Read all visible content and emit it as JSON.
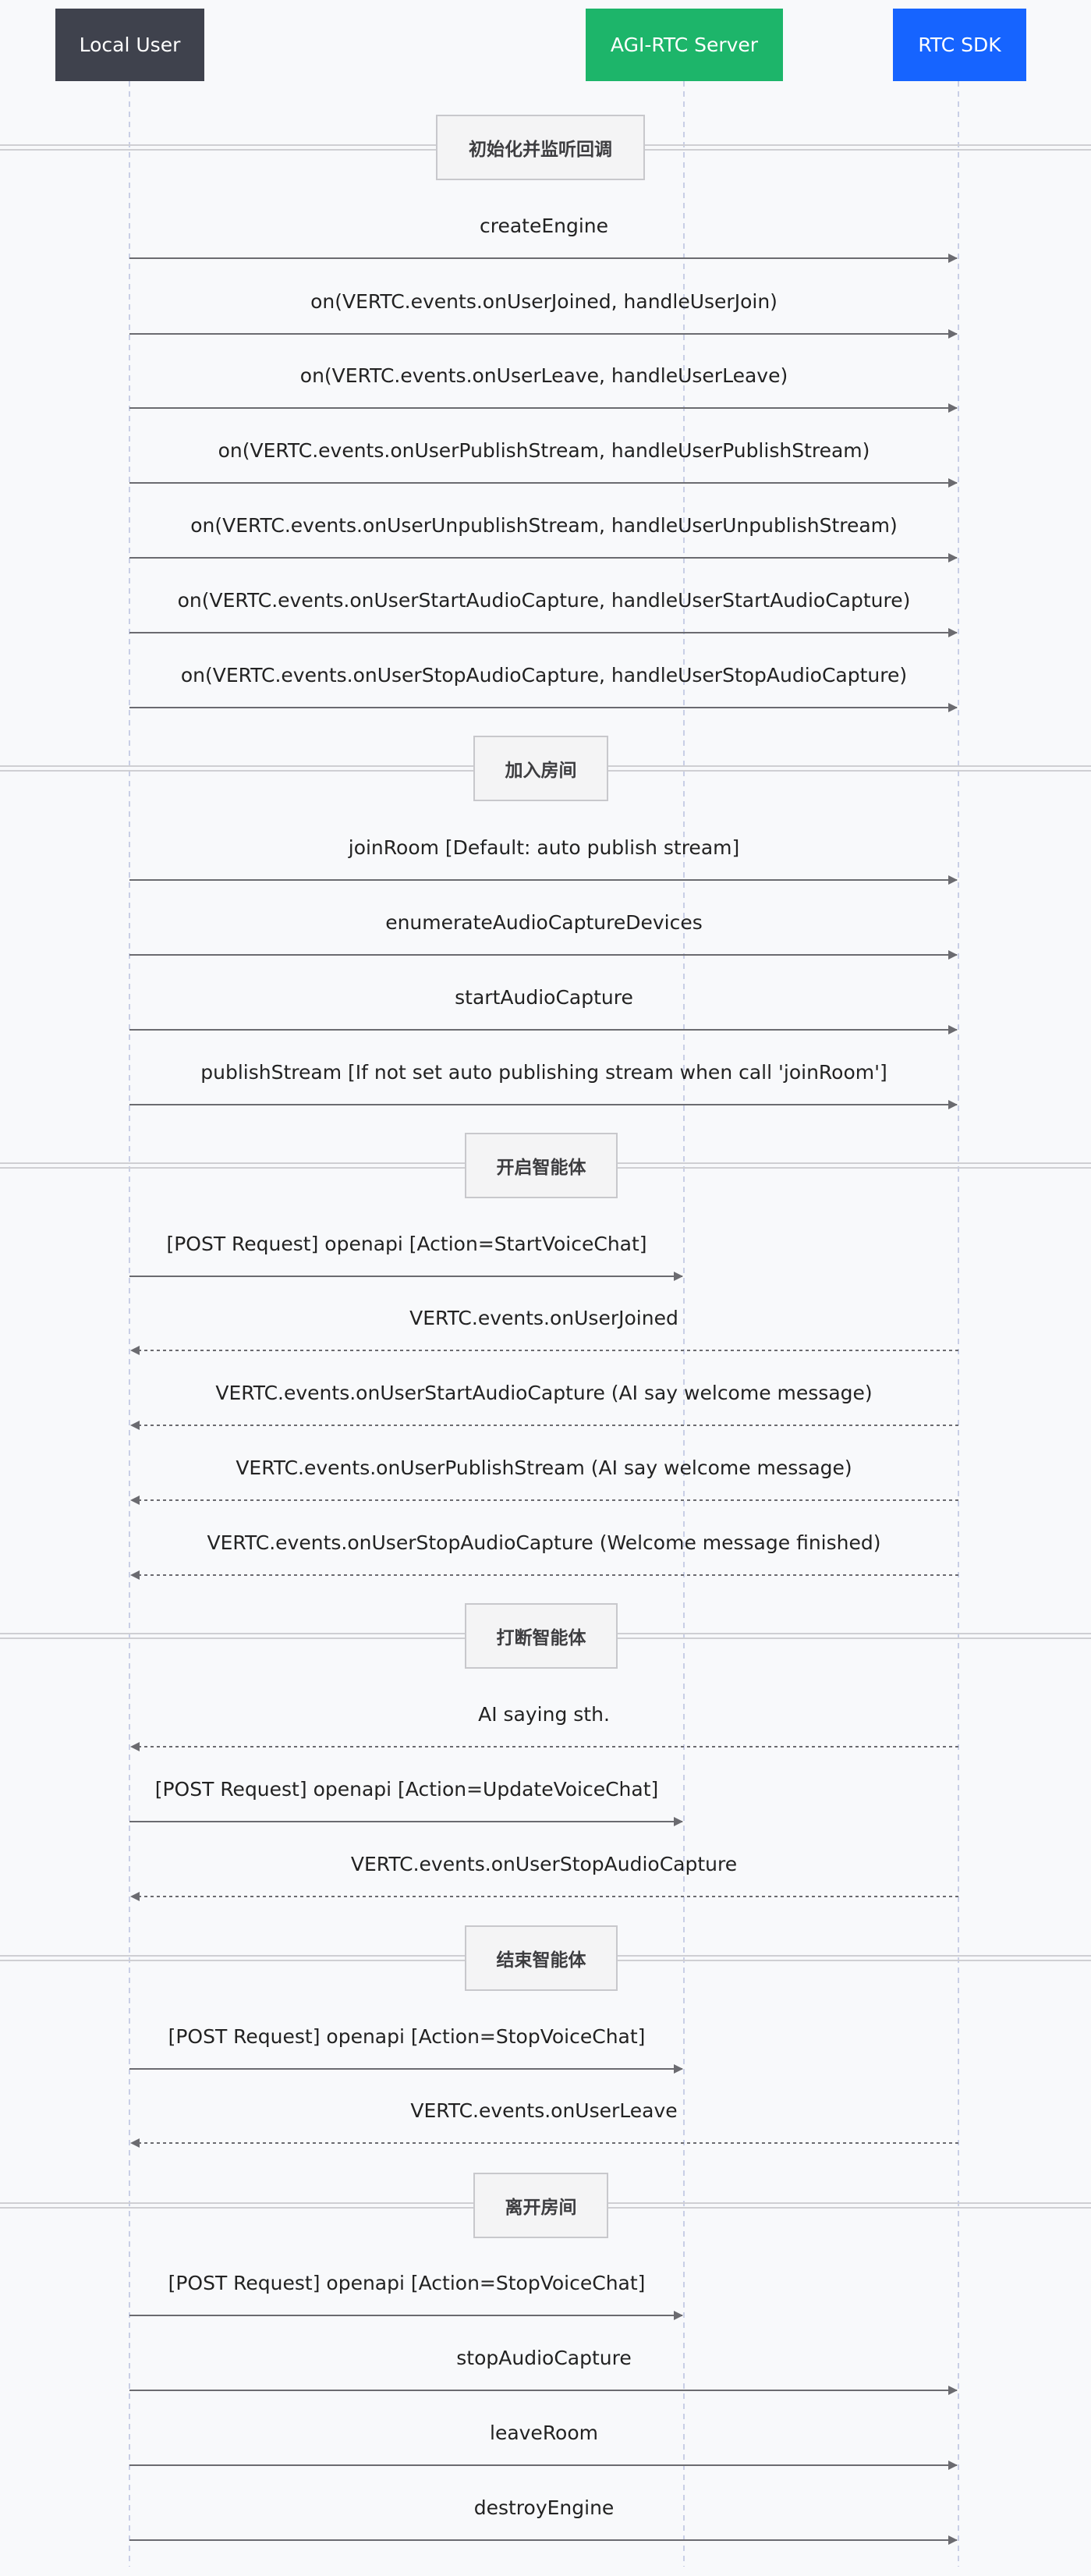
{
  "participants": [
    {
      "id": "local",
      "name": "Local User",
      "color": "#3f424d"
    },
    {
      "id": "server",
      "name": "AGI-RTC Server",
      "color": "#1db56a"
    },
    {
      "id": "sdk",
      "name": "RTC SDK",
      "color": "#1664ff"
    }
  ],
  "sections": [
    "初始化并监听回调",
    "加入房间",
    "开启智能体",
    "打断智能体",
    "结束智能体",
    "离开房间"
  ],
  "messages": [
    {
      "from": "local",
      "to": "sdk",
      "text": "createEngine",
      "style": "solid"
    },
    {
      "from": "local",
      "to": "sdk",
      "text": "on(VERTC.events.onUserJoined, handleUserJoin)",
      "style": "solid"
    },
    {
      "from": "local",
      "to": "sdk",
      "text": "on(VERTC.events.onUserLeave, handleUserLeave)",
      "style": "solid"
    },
    {
      "from": "local",
      "to": "sdk",
      "text": "on(VERTC.events.onUserPublishStream, handleUserPublishStream)",
      "style": "solid"
    },
    {
      "from": "local",
      "to": "sdk",
      "text": "on(VERTC.events.onUserUnpublishStream, handleUserUnpublishStream)",
      "style": "solid"
    },
    {
      "from": "local",
      "to": "sdk",
      "text": "on(VERTC.events.onUserStartAudioCapture, handleUserStartAudioCapture)",
      "style": "solid"
    },
    {
      "from": "local",
      "to": "sdk",
      "text": "on(VERTC.events.onUserStopAudioCapture, handleUserStopAudioCapture)",
      "style": "solid"
    },
    {
      "from": "local",
      "to": "sdk",
      "text": "joinRoom [Default: auto publish stream]",
      "style": "solid"
    },
    {
      "from": "local",
      "to": "sdk",
      "text": "enumerateAudioCaptureDevices",
      "style": "solid"
    },
    {
      "from": "local",
      "to": "sdk",
      "text": "startAudioCapture",
      "style": "solid"
    },
    {
      "from": "local",
      "to": "sdk",
      "text": "publishStream [If not set auto publishing stream when call 'joinRoom']",
      "style": "solid"
    },
    {
      "from": "local",
      "to": "server",
      "text": "[POST Request] openapi [Action=StartVoiceChat]",
      "style": "solid"
    },
    {
      "from": "sdk",
      "to": "local",
      "text": "VERTC.events.onUserJoined",
      "style": "dashed"
    },
    {
      "from": "sdk",
      "to": "local",
      "text": "VERTC.events.onUserStartAudioCapture (AI say welcome message)",
      "style": "dashed"
    },
    {
      "from": "sdk",
      "to": "local",
      "text": "VERTC.events.onUserPublishStream (AI say welcome message)",
      "style": "dashed"
    },
    {
      "from": "sdk",
      "to": "local",
      "text": "VERTC.events.onUserStopAudioCapture (Welcome message finished)",
      "style": "dashed"
    },
    {
      "from": "sdk",
      "to": "local",
      "text": "AI saying sth.",
      "style": "dashed"
    },
    {
      "from": "local",
      "to": "server",
      "text": "[POST Request] openapi [Action=UpdateVoiceChat]",
      "style": "solid"
    },
    {
      "from": "sdk",
      "to": "local",
      "text": "VERTC.events.onUserStopAudioCapture",
      "style": "dashed"
    },
    {
      "from": "local",
      "to": "server",
      "text": "[POST Request] openapi [Action=StopVoiceChat]",
      "style": "solid"
    },
    {
      "from": "sdk",
      "to": "local",
      "text": "VERTC.events.onUserLeave",
      "style": "dashed"
    },
    {
      "from": "local",
      "to": "server",
      "text": "[POST Request] openapi [Action=StopVoiceChat]",
      "style": "solid"
    },
    {
      "from": "local",
      "to": "sdk",
      "text": "stopAudioCapture",
      "style": "solid"
    },
    {
      "from": "local",
      "to": "sdk",
      "text": "leaveRoom",
      "style": "solid"
    },
    {
      "from": "local",
      "to": "sdk",
      "text": "destroyEngine",
      "style": "solid"
    }
  ]
}
